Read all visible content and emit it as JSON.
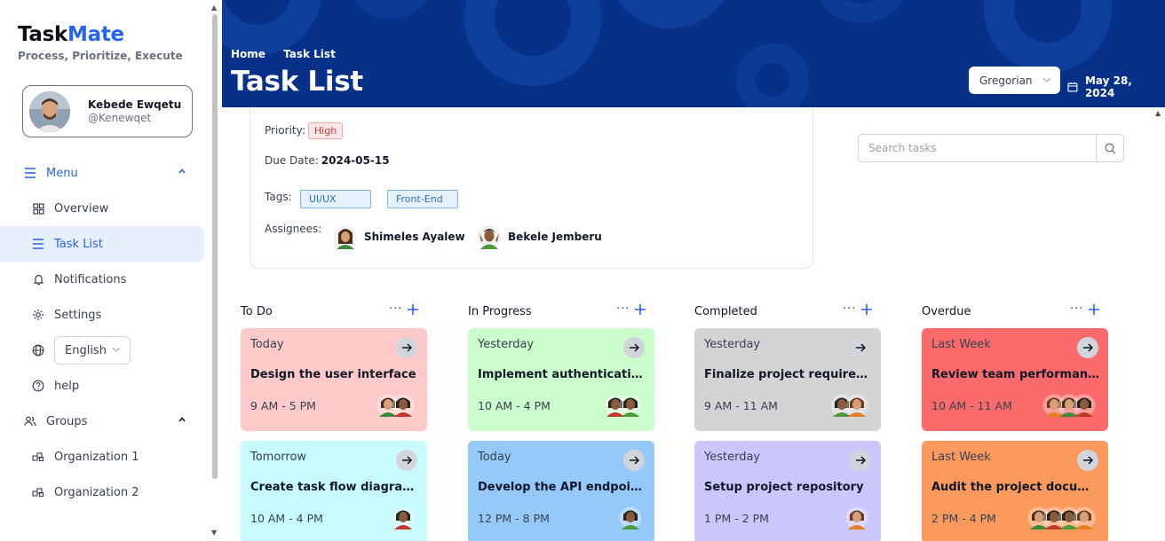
{
  "brand": {
    "part1": "Task",
    "part2": "Mate",
    "tagline": "Process, Prioritize, Execute"
  },
  "profile": {
    "name": "Kebede Ewqetu",
    "handle": "@Kenewqet"
  },
  "sidebar": {
    "menu_label": "Menu",
    "items": [
      {
        "label": "Overview",
        "icon": "grid-icon"
      },
      {
        "label": "Task List",
        "icon": "list-icon",
        "active": true
      },
      {
        "label": "Notifications",
        "icon": "bell-icon"
      },
      {
        "label": "Settings",
        "icon": "gear-icon"
      }
    ],
    "language": "English",
    "help_label": "help",
    "groups_label": "Groups",
    "groups": [
      {
        "label": "Organization 1",
        "icon": "org-icon"
      },
      {
        "label": "Organization 2",
        "icon": "org-icon"
      }
    ]
  },
  "header": {
    "breadcrumb_home": "Home",
    "breadcrumb_current": "Task List",
    "title": "Task List",
    "calendar_type": "Gregorian",
    "date": "May 28, 2024"
  },
  "detail": {
    "priority_label": "Priority:",
    "priority_value": "High",
    "due_label": "Due Date:",
    "due_value": "2024-05-15",
    "tags_label": "Tags:",
    "tags": [
      "UI/UX",
      "Front-End"
    ],
    "assignees_label": "Assignees:",
    "assignees": [
      "Shimeles Ayalew",
      "Bekele Jemberu"
    ]
  },
  "search": {
    "placeholder": "Search tasks"
  },
  "columns": [
    {
      "title": "To Do",
      "cards": [
        {
          "when": "Today",
          "name": "Design the user interface",
          "time": "9 AM - 5 PM",
          "color": "#fdc9c9",
          "faces": 2
        },
        {
          "when": "Tomorrow",
          "name": "Create task flow diagrams",
          "time": "10 AM - 4 PM",
          "color": "#c8fbfb",
          "faces": 1
        }
      ]
    },
    {
      "title": "In Progress",
      "cards": [
        {
          "when": "Yesterday",
          "name": "Implement authentication system",
          "time": "10 AM - 4 PM",
          "color": "#cbfccb",
          "faces": 2
        },
        {
          "when": "Today",
          "name": "Develop the API endpoints",
          "time": "12 PM - 8 PM",
          "color": "#94c9fa",
          "faces": 1
        }
      ]
    },
    {
      "title": "Completed",
      "cards": [
        {
          "when": "Yesterday",
          "name": "Finalize project requirements",
          "time": "9 AM - 11 AM",
          "color": "#d4d4d4",
          "faces": 2
        },
        {
          "when": "Yesterday",
          "name": "Setup project repository",
          "time": "1 PM - 2 PM",
          "color": "#cbc6fb",
          "faces": 1
        }
      ]
    },
    {
      "title": "Overdue",
      "cards": [
        {
          "when": "Last Week",
          "name": "Review team performance",
          "time": "10 AM - 11 AM",
          "color": "#fb6b6b",
          "faces": 3
        },
        {
          "when": "Last Week",
          "name": "Audit the project documentation",
          "time": "2 PM - 4 PM",
          "color": "#fb9a5c",
          "faces": 4
        }
      ]
    }
  ]
}
